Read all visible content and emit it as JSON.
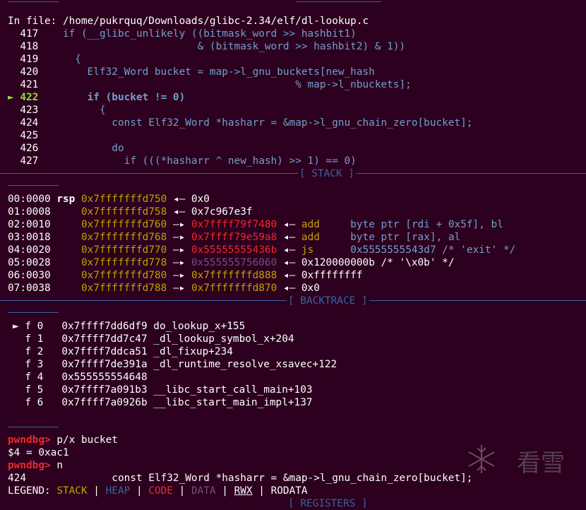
{
  "source": {
    "file_prefix": "In file: ",
    "file_path": "/home/pukrquq/Downloads/glibc-2.34/elf/dl-lookup.c",
    "lines": [
      {
        "no": "417",
        "code": "  if (__glibc_unlikely ((bitmask_word >> hashbit1)"
      },
      {
        "no": "418",
        "code": "                        & (bitmask_word >> hashbit2) & 1))"
      },
      {
        "no": "419",
        "code": "    {"
      },
      {
        "no": "420",
        "code": "      Elf32_Word bucket = map->l_gnu_buckets[new_hash"
      },
      {
        "no": "421",
        "code": "                                        % map->l_nbuckets];"
      },
      {
        "no": "422",
        "code": "      if (bucket != 0)",
        "current": true
      },
      {
        "no": "423",
        "code": "        {"
      },
      {
        "no": "424",
        "code": "          const Elf32_Word *hasharr = &map->l_gnu_chain_zero[bucket];"
      },
      {
        "no": "425",
        "code": ""
      },
      {
        "no": "426",
        "code": "          do"
      },
      {
        "no": "427",
        "code": "            if (((*hasharr ^ new_hash) >> 1) == 0)"
      }
    ],
    "current_marker": "►"
  },
  "stack": {
    "header": "[ STACK ]",
    "rows": [
      {
        "off": "00:0000",
        "reg": "rsp",
        "addr": "0x7fffffffd750",
        "rest": "◂— 0x0"
      },
      {
        "off": "01:0008",
        "reg": "",
        "addr": "0x7fffffffd758",
        "rest": "◂— 0x7c967e3f"
      },
      {
        "off": "02:0010",
        "reg": "",
        "addr": "0x7fffffffd760",
        "arrow": "—▸",
        "ptr": "0x7ffff79f7480",
        "rest2": "◂— add",
        "ins": "byte ptr [rdi + 0x5f], bl"
      },
      {
        "off": "03:0018",
        "reg": "",
        "addr": "0x7fffffffd768",
        "arrow": "—▸",
        "ptr": "0x7ffff79e59a8",
        "rest2": "◂— add",
        "ins": "byte ptr [rax], al"
      },
      {
        "off": "04:0020",
        "reg": "",
        "addr": "0x7fffffffd770",
        "arrow": "—▸",
        "ptr": "0x55555555436b",
        "rest2": "◂— js",
        "ins": "0x5555555543d7 /* 'exit' */"
      },
      {
        "off": "05:0028",
        "reg": "",
        "addr": "0x7fffffffd778",
        "arrow": "—▸",
        "ptr": "0x555555756060",
        "rest": "◂— 0x120000000b /* '\\x0b' */"
      },
      {
        "off": "06:0030",
        "reg": "",
        "addr": "0x7fffffffd780",
        "arrow": "—▸",
        "ptr": "0x7fffffffd888",
        "rest": "◂— 0xffffffff"
      },
      {
        "off": "07:0038",
        "reg": "",
        "addr": "0x7fffffffd788",
        "arrow": "—▸",
        "ptr": "0x7fffffffd870",
        "rest": "◂— 0x0"
      }
    ]
  },
  "backtrace": {
    "header": "[ BACKTRACE ]",
    "marker": "►",
    "frames": [
      {
        "f": "f 0",
        "addr": "0x7ffff7dd6df9",
        "sym": "do_lookup_x+155"
      },
      {
        "f": "f 1",
        "addr": "0x7ffff7dd7c47",
        "sym": "_dl_lookup_symbol_x+204"
      },
      {
        "f": "f 2",
        "addr": "0x7ffff7ddca51",
        "sym": "_dl_fixup+234"
      },
      {
        "f": "f 3",
        "addr": "0x7ffff7de391a",
        "sym": "_dl_runtime_resolve_xsavec+122"
      },
      {
        "f": "f 4",
        "addr": "0x555555554648",
        "sym": ""
      },
      {
        "f": "f 5",
        "addr": "0x7ffff7a091b3",
        "sym": "__libc_start_call_main+103"
      },
      {
        "f": "f 6",
        "addr": "0x7ffff7a0926b",
        "sym": "__libc_start_main_impl+137"
      }
    ]
  },
  "console": {
    "prompt": "pwndbg>",
    "cmd1": " p/x bucket",
    "out1": "$4 = 0xac1",
    "cmd2": " n",
    "out2_no": "424",
    "out2_code": "              const Elf32_Word *hasharr = &map->l_gnu_chain_zero[bucket];"
  },
  "legend": {
    "label": "LEGEND: ",
    "stack": "STACK",
    "heap": "HEAP",
    "code": "CODE",
    "data": "DATA",
    "rwx": "RWX",
    "rodata": "RODATA",
    "sep": " | "
  },
  "registers_header": "[ REGISTERS ]",
  "watermark": "看雪"
}
